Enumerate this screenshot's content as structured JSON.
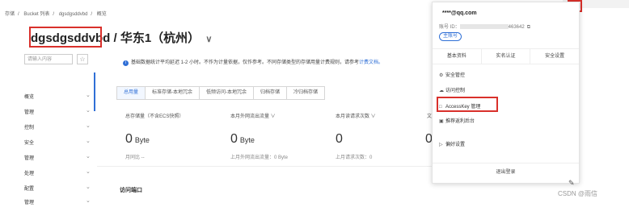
{
  "breadcrumb": {
    "items": [
      "存储",
      "Bucket 列表",
      "dgsdgsddvbd",
      "概览"
    ],
    "sep": "/"
  },
  "bucket": {
    "name": "dgsdgsddvbd",
    "region": "/ 华东1（杭州）",
    "chevron": "∨"
  },
  "sidebar": {
    "search_placeholder": "请输入内容",
    "items": [
      {
        "label": "概览"
      },
      {
        "label": "管理"
      },
      {
        "label": "控制"
      },
      {
        "label": "安全"
      },
      {
        "label": "管理"
      },
      {
        "label": "处理"
      },
      {
        "label": "配置"
      },
      {
        "label": "管理"
      }
    ]
  },
  "info_bar": {
    "text": "基础数据统计平均延迟 1-2 小时。不作为计量依据，仅作参考。不同存储类型的存储用量计费规则，请参考",
    "link": "计费文档。"
  },
  "tabs": [
    "总用量",
    "标准存储-本地冗余",
    "低频访问-本地冗余",
    "归档存储",
    "冷归档存储"
  ],
  "stats": [
    {
      "label": "总存储量（不含ECS快照）",
      "value": "0",
      "unit": "Byte",
      "sub": "月同比 --"
    },
    {
      "label": "本月外网流出流量 ∨",
      "value": "0",
      "unit": "Byte",
      "sub": "上月外网流出流量：0 Byte"
    },
    {
      "label": "本月读请求次数 ∨",
      "value": "0",
      "unit": "",
      "sub": "上月请求次数：0"
    },
    {
      "label": "文",
      "value": "0",
      "unit": "",
      "sub": ""
    }
  ],
  "section": {
    "title": "访问端口"
  },
  "popup": {
    "email": "****@qq.com",
    "account_prefix": "账号 ID：",
    "account_tail": "463642",
    "badge": "主账号",
    "tabs": [
      "基本资料",
      "实名认证",
      "安全设置"
    ],
    "items": [
      {
        "icon": "⚙",
        "label": "安全管控"
      },
      {
        "icon": "☁",
        "label": "访问控制"
      },
      {
        "icon": "□",
        "label": "AccessKey 管理"
      },
      {
        "icon": "▣",
        "label": "推荐返利后台"
      },
      {
        "icon": "▷",
        "label": "偏好设置"
      }
    ],
    "logout": "退出登录"
  },
  "watermark": "CSDN @雨信",
  "colors": {
    "highlight": "#d9302b",
    "accent": "#2f6fd6"
  }
}
